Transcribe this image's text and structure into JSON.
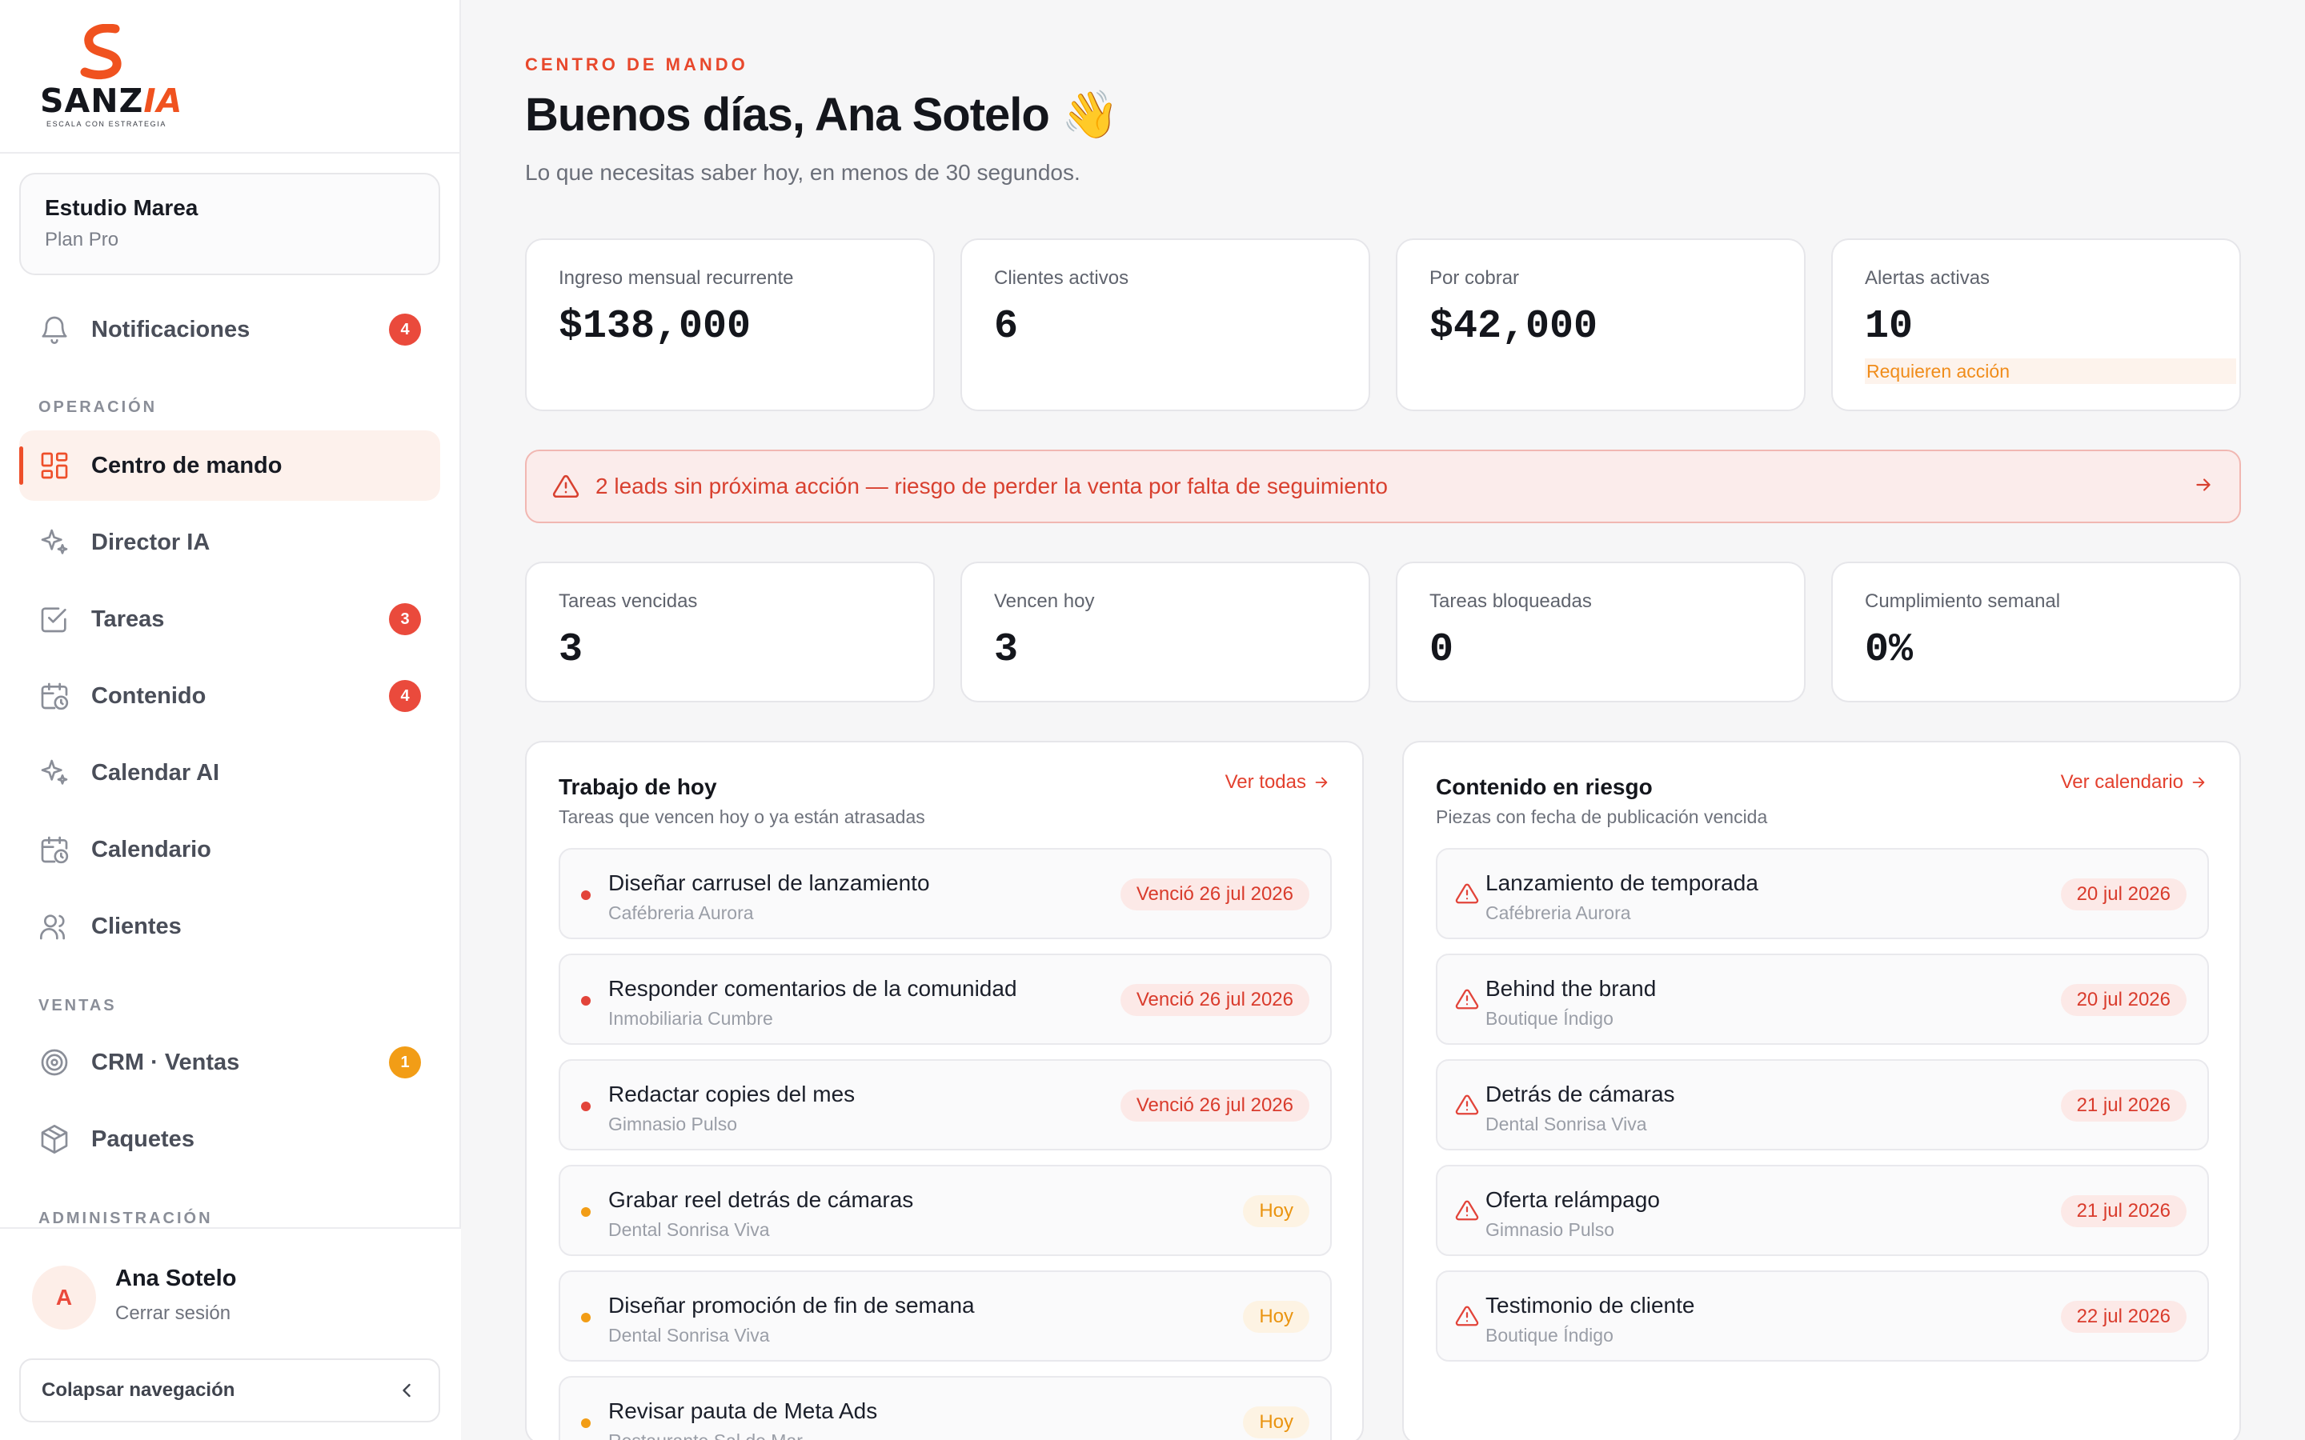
{
  "brand": {
    "wordmark_main": "SANZ",
    "wordmark_accent": "IA",
    "tagline": "ESCALA CON ESTRATEGIA",
    "accent_color": "#f0521f"
  },
  "workspace": {
    "name": "Estudio Marea",
    "plan": "Plan Pro"
  },
  "nav": {
    "notifications": {
      "label": "Notificaciones",
      "badge": "4",
      "icon": "bell-icon"
    },
    "section_operation": "OPERACIÓN",
    "items_operation": [
      {
        "label": "Centro de mando",
        "icon": "dashboard-icon",
        "active": true
      },
      {
        "label": "Director IA",
        "icon": "sparkles-icon"
      },
      {
        "label": "Tareas",
        "icon": "checkbox-icon",
        "badge": "3"
      },
      {
        "label": "Contenido",
        "icon": "calendar-clock-icon",
        "badge": "4"
      },
      {
        "label": "Calendar AI",
        "icon": "sparkles-icon"
      },
      {
        "label": "Calendario",
        "icon": "calendar-clock-icon"
      },
      {
        "label": "Clientes",
        "icon": "users-icon"
      }
    ],
    "section_sales": "VENTAS",
    "items_sales": [
      {
        "label": "CRM · Ventas",
        "icon": "target-icon",
        "badge": "1"
      },
      {
        "label": "Paquetes",
        "icon": "package-icon"
      }
    ],
    "section_admin": "ADMINISTRACIÓN"
  },
  "user": {
    "initial": "A",
    "name": "Ana Sotelo",
    "logout_label": "Cerrar sesión"
  },
  "collapse_label": "Colapsar navegación",
  "header": {
    "eyebrow": "CENTRO DE MANDO",
    "greeting": "Buenos días, Ana Sotelo 👋",
    "subtitle": "Lo que necesitas saber hoy, en menos de 30 segundos."
  },
  "stats_top": [
    {
      "label": "Ingreso mensual recurrente",
      "value": "$138,000"
    },
    {
      "label": "Clientes activos",
      "value": "6"
    },
    {
      "label": "Por cobrar",
      "value": "$42,000"
    },
    {
      "label": "Alertas activas",
      "value": "10",
      "note": "Requieren acción"
    }
  ],
  "alert": {
    "text": "2 leads sin próxima acción — riesgo de perder la venta por falta de seguimiento"
  },
  "stats_tasks": [
    {
      "label": "Tareas vencidas",
      "value": "3"
    },
    {
      "label": "Vencen hoy",
      "value": "3"
    },
    {
      "label": "Tareas bloqueadas",
      "value": "0"
    },
    {
      "label": "Cumplimiento semanal",
      "value": "0%"
    }
  ],
  "work_today": {
    "title": "Trabajo de hoy",
    "subtitle": "Tareas que vencen hoy o ya están atrasadas",
    "link": "Ver todas",
    "items": [
      {
        "title": "Diseñar carrusel de lanzamiento",
        "client": "Cafébreria Aurora",
        "status": "Venció 26 jul 2026",
        "level": "red"
      },
      {
        "title": "Responder comentarios de la comunidad",
        "client": "Inmobiliaria Cumbre",
        "status": "Venció 26 jul 2026",
        "level": "red"
      },
      {
        "title": "Redactar copies del mes",
        "client": "Gimnasio Pulso",
        "status": "Venció 26 jul 2026",
        "level": "red"
      },
      {
        "title": "Grabar reel detrás de cámaras",
        "client": "Dental Sonrisa Viva",
        "status": "Hoy",
        "level": "amber"
      },
      {
        "title": "Diseñar promoción de fin de semana",
        "client": "Dental Sonrisa Viva",
        "status": "Hoy",
        "level": "amber"
      },
      {
        "title": "Revisar pauta de Meta Ads",
        "client": "Restaurante Sal de Mar",
        "status": "Hoy",
        "level": "amber"
      }
    ]
  },
  "content_risk": {
    "title": "Contenido en riesgo",
    "subtitle": "Piezas con fecha de publicación vencida",
    "link": "Ver calendario",
    "items": [
      {
        "title": "Lanzamiento de temporada",
        "client": "Cafébreria Aurora",
        "date": "20 jul 2026"
      },
      {
        "title": "Behind the brand",
        "client": "Boutique Índigo",
        "date": "20 jul 2026"
      },
      {
        "title": "Detrás de cámaras",
        "client": "Dental Sonrisa Viva",
        "date": "21 jul 2026"
      },
      {
        "title": "Oferta relámpago",
        "client": "Gimnasio Pulso",
        "date": "21 jul 2026"
      },
      {
        "title": "Testimonio de cliente",
        "client": "Boutique Índigo",
        "date": "22 jul 2026"
      }
    ]
  }
}
